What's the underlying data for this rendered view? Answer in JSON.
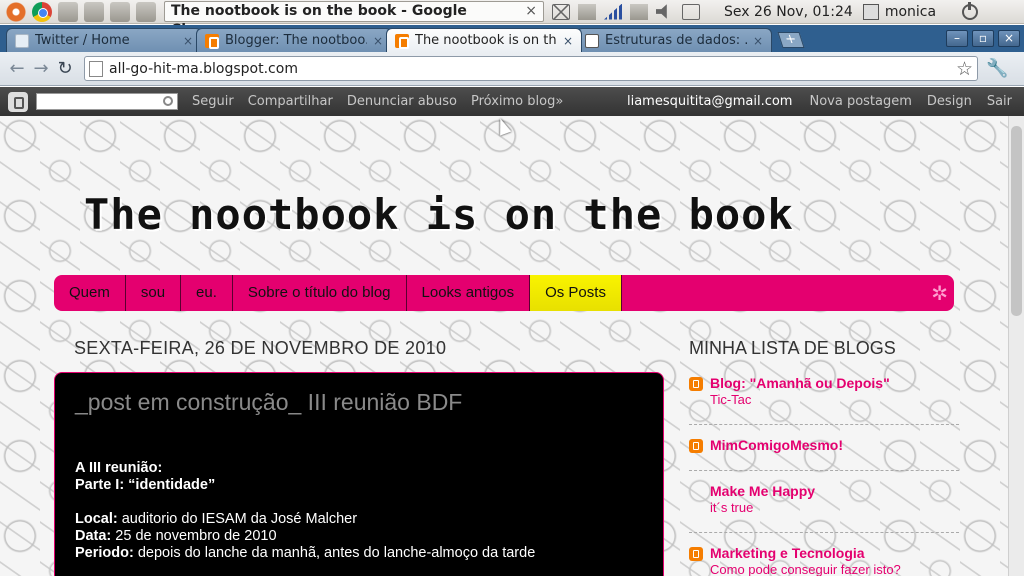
{
  "system_panel": {
    "window_title": "The nootbook is on the book - Google Chrome",
    "window_close": "×",
    "clock": "Sex 26 Nov, 01:24",
    "username": "monica"
  },
  "browser": {
    "tabs": [
      {
        "title": "Twitter / Home",
        "close": "×"
      },
      {
        "title": "Blogger: The nootboo...",
        "close": "×"
      },
      {
        "title": "The nootbook is on th...",
        "close": "×"
      },
      {
        "title": "Estruturas de dados: ...",
        "close": "×"
      }
    ],
    "new_tab": "+",
    "window_controls": {
      "minimize": "–",
      "maximize": "▫",
      "close": "×"
    },
    "nav": {
      "back": "←",
      "forward": "→",
      "reload": "↻"
    },
    "url": "all-go-hit-ma.blogspot.com",
    "star": "☆",
    "wrench": "🔧"
  },
  "blogger_navbar": {
    "links": [
      "Seguir",
      "Compartilhar",
      "Denunciar abuso",
      "Próximo blog»"
    ],
    "email": "liamesquitita@gmail.com",
    "right_links": [
      "Nova postagem",
      "Design",
      "Sair"
    ]
  },
  "blog": {
    "title": "The nootbook is on the book",
    "tabs": [
      "Quem",
      "sou",
      "eu.",
      "Sobre o título do blog",
      "Looks antigos",
      "Os Posts"
    ],
    "current_tab_index": 5,
    "tabs_deco": "✲",
    "date_header": "Sexta-feira, 26 de novembro de 2010",
    "post": {
      "title": "_post em construção_ III reunião BDF",
      "line1": "A III reunião:",
      "line2": "Parte I: “identidade”",
      "local_label": "Local:",
      "local_value": " auditorio do IESAM da José Malcher",
      "data_label": "Data:",
      "data_value": " 25 de novembro de 2010",
      "periodo_label": "Periodo:",
      "periodo_value": " depois do lanche da manhã, antes do lanche-almoço da tarde"
    },
    "sidebar": {
      "title": "Minha lista de blogs",
      "blogs": [
        {
          "name": "Blog: \"Amanhã ou Depois\"",
          "post": "Tic-Tac"
        },
        {
          "name": "MimComigoMesmo!",
          "post": ""
        },
        {
          "name": "Make Me Happy",
          "post": "it´s true"
        },
        {
          "name": "Marketing e Tecnologia",
          "post": "Como pode conseguir fazer isto?"
        }
      ]
    }
  },
  "colors": {
    "accent_pink": "#e4006f",
    "tab_current_yellow": "#f9f300",
    "chrome_frame": "#2f5f8f"
  }
}
